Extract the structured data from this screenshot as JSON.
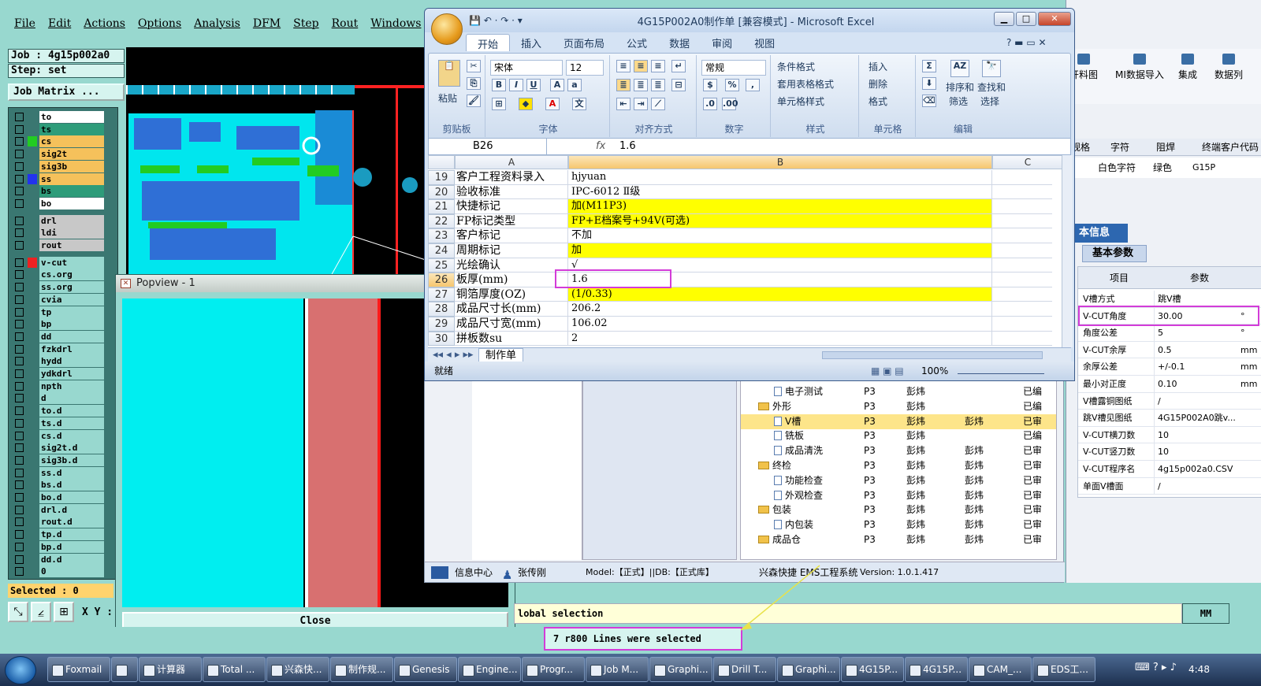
{
  "cam": {
    "menu": [
      "File",
      "Edit",
      "Actions",
      "Options",
      "Analysis",
      "DFM",
      "Step",
      "Rout",
      "Windows"
    ],
    "job_line": "Job : 4g15p002a0",
    "step_line": "Step: set",
    "job_matrix": "Job Matrix ...",
    "layers": [
      {
        "name": "to",
        "color": "#ffffff",
        "swatch": ""
      },
      {
        "name": "ts",
        "color": "#2e9c7a",
        "swatch": ""
      },
      {
        "name": "cs",
        "color": "#f5c15b",
        "swatch": "#22cc22"
      },
      {
        "name": "sig2t",
        "color": "#f5c15b",
        "swatch": ""
      },
      {
        "name": "sig3b",
        "color": "#f5c15b",
        "swatch": ""
      },
      {
        "name": "ss",
        "color": "#f5c15b",
        "swatch": "#2233ee"
      },
      {
        "name": "bs",
        "color": "#2e9c7a",
        "swatch": ""
      },
      {
        "name": "bo",
        "color": "#ffffff",
        "swatch": ""
      },
      {
        "name": "drl",
        "color": "#c8c8c8",
        "swatch": ""
      },
      {
        "name": "ldi",
        "color": "#c8c8c8",
        "swatch": ""
      },
      {
        "name": "rout",
        "color": "#c8c8c8",
        "swatch": ""
      },
      {
        "name": "v-cut",
        "color": "#98d8cf",
        "swatch": "#ee2222"
      },
      {
        "name": "cs.org",
        "color": "#98d8cf",
        "swatch": ""
      },
      {
        "name": "ss.org",
        "color": "#98d8cf",
        "swatch": ""
      },
      {
        "name": "cvia",
        "color": "#98d8cf",
        "swatch": ""
      },
      {
        "name": "tp",
        "color": "#98d8cf",
        "swatch": ""
      },
      {
        "name": "bp",
        "color": "#98d8cf",
        "swatch": ""
      },
      {
        "name": "dd",
        "color": "#98d8cf",
        "swatch": ""
      },
      {
        "name": "fzkdrl",
        "color": "#98d8cf",
        "swatch": ""
      },
      {
        "name": "hydd",
        "color": "#98d8cf",
        "swatch": ""
      },
      {
        "name": "ydkdrl",
        "color": "#98d8cf",
        "swatch": ""
      },
      {
        "name": "npth",
        "color": "#98d8cf",
        "swatch": ""
      },
      {
        "name": "d",
        "color": "#98d8cf",
        "swatch": ""
      },
      {
        "name": "to.d",
        "color": "#98d8cf",
        "swatch": ""
      },
      {
        "name": "ts.d",
        "color": "#98d8cf",
        "swatch": ""
      },
      {
        "name": "cs.d",
        "color": "#98d8cf",
        "swatch": ""
      },
      {
        "name": "sig2t.d",
        "color": "#98d8cf",
        "swatch": ""
      },
      {
        "name": "sig3b.d",
        "color": "#98d8cf",
        "swatch": ""
      },
      {
        "name": "ss.d",
        "color": "#98d8cf",
        "swatch": ""
      },
      {
        "name": "bs.d",
        "color": "#98d8cf",
        "swatch": ""
      },
      {
        "name": "bo.d",
        "color": "#98d8cf",
        "swatch": ""
      },
      {
        "name": "drl.d",
        "color": "#98d8cf",
        "swatch": ""
      },
      {
        "name": "rout.d",
        "color": "#98d8cf",
        "swatch": ""
      },
      {
        "name": "tp.d",
        "color": "#98d8cf",
        "swatch": ""
      },
      {
        "name": "bp.d",
        "color": "#98d8cf",
        "swatch": ""
      },
      {
        "name": "dd.d",
        "color": "#98d8cf",
        "swatch": ""
      },
      {
        "name": "0",
        "color": "#98d8cf",
        "swatch": ""
      }
    ],
    "selected": "Selected : 0",
    "xy_label": "X Y :",
    "popview_title": "Popview - 1",
    "popview_close": "Close",
    "global_selection": "lobal selection",
    "units": "MM",
    "lines_selected": "7 r800 Lines were selected"
  },
  "excel": {
    "title": "4G15P002A0制作单 [兼容模式] - Microsoft Excel",
    "tabs": [
      "开始",
      "插入",
      "页面布局",
      "公式",
      "数据",
      "审阅",
      "视图"
    ],
    "ribbon": {
      "clipboard": {
        "paste": "粘贴",
        "label": "剪贴板"
      },
      "font": {
        "name": "宋体",
        "size": "12",
        "label": "字体"
      },
      "align": {
        "label": "对齐方式"
      },
      "number": {
        "format": "常规",
        "label": "数字"
      },
      "styles": {
        "cond": "条件格式",
        "table": "套用表格格式",
        "cell": "单元格样式",
        "label": "样式"
      },
      "cells": {
        "insert": "插入",
        "delete": "删除",
        "format": "格式",
        "label": "单元格"
      },
      "edit": {
        "sort": "排序和",
        "filter": "筛选",
        "find": "查找和",
        "select": "选择",
        "label": "编辑"
      }
    },
    "name_box": "B26",
    "fx": "fx",
    "formula_value": "1.6",
    "columns": [
      "A",
      "B",
      "C"
    ],
    "rows": [
      {
        "n": "19",
        "a": "客户工程资料录入",
        "b": "hjyuan",
        "yellow": false
      },
      {
        "n": "20",
        "a": "验收标准",
        "b": "IPC-6012 Ⅱ级",
        "yellow": false
      },
      {
        "n": "21",
        "a": "快捷标记",
        "b": "加(M11P3)",
        "yellow": true
      },
      {
        "n": "22",
        "a": "FP标记类型",
        "b": "FP+E档案号+94V(可选)",
        "yellow": true
      },
      {
        "n": "23",
        "a": "客户标记",
        "b": "不加",
        "yellow": false
      },
      {
        "n": "24",
        "a": "周期标记",
        "b": "加",
        "yellow": true
      },
      {
        "n": "25",
        "a": "光绘确认",
        "b": "√",
        "yellow": false
      },
      {
        "n": "26",
        "a": "板厚(mm)",
        "b": "1.6",
        "yellow": false
      },
      {
        "n": "27",
        "a": "铜箔厚度(OZ)",
        "b": "(1/0.33)",
        "yellow": true
      },
      {
        "n": "28",
        "a": "成品尺寸长(mm)",
        "b": "206.2",
        "yellow": false
      },
      {
        "n": "29",
        "a": "成品尺寸宽(mm)",
        "b": "106.02",
        "yellow": false
      },
      {
        "n": "30",
        "a": "拼板数su",
        "b": "2",
        "yellow": false
      }
    ],
    "sheet_tab": "制作单",
    "status_ready": "就绪",
    "zoom": "100%"
  },
  "eds": {
    "tree": [
      {
        "label": "电子测试",
        "kind": "doc",
        "c1": "P3",
        "c2": "彭炜",
        "c3": "",
        "c4": "已编",
        "hl": false
      },
      {
        "label": "外形",
        "kind": "folder",
        "c1": "P3",
        "c2": "彭炜",
        "c3": "",
        "c4": "已编",
        "hl": false
      },
      {
        "label": "V槽",
        "kind": "doc",
        "c1": "P3",
        "c2": "彭炜",
        "c3": "彭炜",
        "c4": "已审",
        "hl": true
      },
      {
        "label": "铣板",
        "kind": "doc",
        "c1": "P3",
        "c2": "彭炜",
        "c3": "",
        "c4": "已编",
        "hl": false
      },
      {
        "label": "成品清洗",
        "kind": "doc",
        "c1": "P3",
        "c2": "彭炜",
        "c3": "彭炜",
        "c4": "已审",
        "hl": false
      },
      {
        "label": "终检",
        "kind": "folder",
        "c1": "P3",
        "c2": "彭炜",
        "c3": "彭炜",
        "c4": "已审",
        "hl": false
      },
      {
        "label": "功能检查",
        "kind": "doc",
        "c1": "P3",
        "c2": "彭炜",
        "c3": "彭炜",
        "c4": "已审",
        "hl": false
      },
      {
        "label": "外观检查",
        "kind": "doc",
        "c1": "P3",
        "c2": "彭炜",
        "c3": "彭炜",
        "c4": "已审",
        "hl": false
      },
      {
        "label": "包装",
        "kind": "folder",
        "c1": "P3",
        "c2": "彭炜",
        "c3": "彭炜",
        "c4": "已审",
        "hl": false
      },
      {
        "label": "内包装",
        "kind": "doc",
        "c1": "P3",
        "c2": "彭炜",
        "c3": "彭炜",
        "c4": "已审",
        "hl": false
      },
      {
        "label": "成品仓",
        "kind": "folder",
        "c1": "P3",
        "c2": "彭炜",
        "c3": "彭炜",
        "c4": "已审",
        "hl": false
      }
    ],
    "status": {
      "info_center": "信息中心",
      "user": "张传刚",
      "model": "Model:【正式】||DB:【正式库】",
      "system": "兴森快捷 EMS工程系统",
      "version": "Version: 1.0.1.417"
    },
    "toolbar": [
      "开料图",
      "MI数据导入",
      "集成",
      "数据列"
    ],
    "header_cols": [
      "规格",
      "字符",
      "阻焊",
      "终端客户代码"
    ],
    "header_vals": [
      "白色字符",
      "绿色",
      "G15P"
    ],
    "basic_info": "本信息",
    "basic_param": "基本参数",
    "param_head": [
      "项目",
      "参数"
    ],
    "params": [
      {
        "k": "V槽方式",
        "v": "跳V槽",
        "u": ""
      },
      {
        "k": "V-CUT角度",
        "v": "30.00",
        "u": "°"
      },
      {
        "k": "角度公差",
        "v": "5",
        "u": "°"
      },
      {
        "k": "V-CUT余厚",
        "v": "0.5",
        "u": "mm"
      },
      {
        "k": "余厚公差",
        "v": "+/-0.1",
        "u": "mm"
      },
      {
        "k": "最小对正度",
        "v": "0.10",
        "u": "mm"
      },
      {
        "k": "V槽露铜图纸",
        "v": "/",
        "u": ""
      },
      {
        "k": "跳V槽见图纸",
        "v": "4G15P002A0跳v...",
        "u": ""
      },
      {
        "k": "V-CUT横刀数",
        "v": "10",
        "u": ""
      },
      {
        "k": "V-CUT竖刀数",
        "v": "10",
        "u": ""
      },
      {
        "k": "V-CUT程序名",
        "v": "4g15p002a0.CSV",
        "u": ""
      },
      {
        "k": "单面V槽面",
        "v": "/",
        "u": ""
      }
    ]
  },
  "taskbar": {
    "tasks": [
      "Foxmail",
      "",
      "计算器",
      "Total ...",
      "兴森快...",
      "制作规...",
      "Genesis",
      "Engine...",
      "Progr...",
      "Job M...",
      "Graphi...",
      "Drill T...",
      "Graphi...",
      "4G15P...",
      "4G15P...",
      "CAM_...",
      "EDS工..."
    ],
    "clock": "4:48"
  }
}
